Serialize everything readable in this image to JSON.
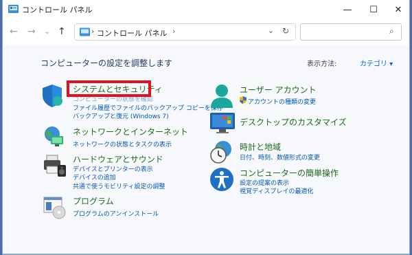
{
  "window": {
    "title": "コントロール パネル",
    "controls": {
      "minimize": "—",
      "maximize": "☐",
      "close": "✕"
    }
  },
  "nav": {
    "back": "←",
    "forward": "→",
    "recent": "⌄",
    "up": "↑",
    "breadcrumb_sep1": "›",
    "breadcrumb": "コントロール パネル",
    "breadcrumb_sep2": "›",
    "dropdown": "⌄",
    "refresh": "↻",
    "search_placeholder": "",
    "search_icon": "⌕"
  },
  "header": {
    "heading": "コンピューターの設定を調整します",
    "view_by_label": "表示方法:",
    "view_by_value": "カテゴリ ▾"
  },
  "categories": {
    "security": {
      "title": "システムとセキュリティ",
      "links": [
        "コンピューターの状態を確認",
        "ファイル履歴でファイルのバックアップ コピーを保存",
        "バックアップと復元 (Windows 7)"
      ]
    },
    "network": {
      "title": "ネットワークとインターネット",
      "links": [
        "ネットワークの状態とタスクの表示"
      ]
    },
    "hardware": {
      "title": "ハードウェアとサウンド",
      "links": [
        "デバイスとプリンターの表示",
        "デバイスの追加",
        "共通で使うモビリティ設定の調整"
      ]
    },
    "programs": {
      "title": "プログラム",
      "links": [
        "プログラムのアンインストール"
      ]
    },
    "accounts": {
      "title": "ユーザー アカウント",
      "links": [
        "アカウントの種類の変更"
      ]
    },
    "desktop": {
      "title": "デスクトップのカスタマイズ",
      "links": []
    },
    "clock": {
      "title": "時計と地域",
      "links": [
        "日付、時刻、数値形式の変更"
      ]
    },
    "ease": {
      "title": "コンピューターの簡単操作",
      "links": [
        "設定の提案の表示",
        "視覚ディスプレイの最適化"
      ]
    }
  },
  "colors": {
    "category_title": "#1a6b1a",
    "link": "#0057b8",
    "highlight": "#e0121e"
  }
}
